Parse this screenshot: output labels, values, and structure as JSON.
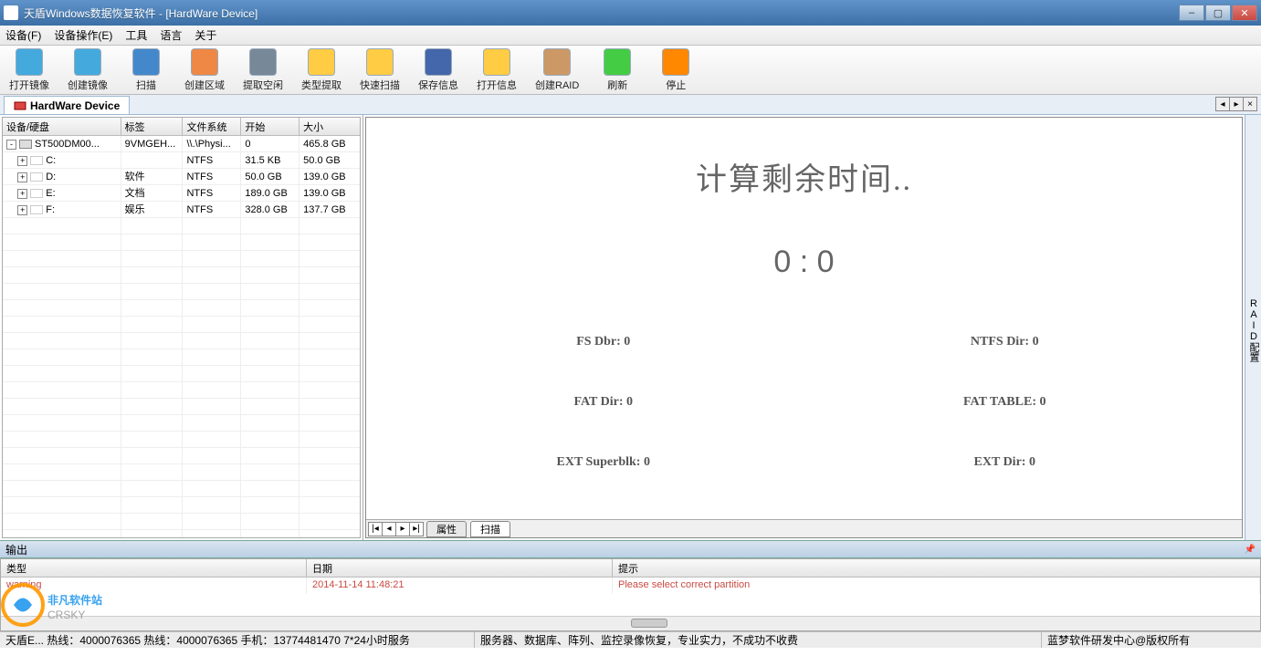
{
  "window": {
    "title": "天盾Windows数据恢复软件 - [HardWare Device]"
  },
  "menu": {
    "device": "设备(F)",
    "device_ops": "设备操作(E)",
    "tools": "工具",
    "language": "语言",
    "about": "关于"
  },
  "toolbar": [
    {
      "id": "open-image",
      "label": "打开镜像"
    },
    {
      "id": "create-image",
      "label": "创建镜像"
    },
    {
      "id": "scan",
      "label": "扫描"
    },
    {
      "id": "create-region",
      "label": "创建区域"
    },
    {
      "id": "extract-free",
      "label": "提取空闲"
    },
    {
      "id": "type-extract",
      "label": "类型提取"
    },
    {
      "id": "quick-scan",
      "label": "快速扫描"
    },
    {
      "id": "save-info",
      "label": "保存信息"
    },
    {
      "id": "open-info",
      "label": "打开信息"
    },
    {
      "id": "create-raid",
      "label": "创建RAID"
    },
    {
      "id": "refresh",
      "label": "刷新"
    },
    {
      "id": "stop",
      "label": "停止"
    }
  ],
  "doc_tab": {
    "label": "HardWare Device"
  },
  "vertical_tab": {
    "label": "RAID配置"
  },
  "device_table": {
    "headers": {
      "device": "设备/硬盘",
      "label": "标签",
      "fs": "文件系统",
      "start": "开始",
      "size": "大小"
    },
    "rows": [
      {
        "indent": 0,
        "exp": "-",
        "icon": true,
        "name": "ST500DM00...",
        "label": "9VMGEH...",
        "fs": "\\\\.\\Physi...",
        "start": "0",
        "size": "465.8 GB"
      },
      {
        "indent": 1,
        "exp": "+",
        "icon": false,
        "name": "C:",
        "label": "",
        "fs": "NTFS",
        "start": "31.5 KB",
        "size": "50.0 GB"
      },
      {
        "indent": 1,
        "exp": "+",
        "icon": false,
        "name": "D:",
        "label": "软件",
        "fs": "NTFS",
        "start": "50.0 GB",
        "size": "139.0 GB"
      },
      {
        "indent": 1,
        "exp": "+",
        "icon": false,
        "name": "E:",
        "label": "文档",
        "fs": "NTFS",
        "start": "189.0 GB",
        "size": "139.0 GB"
      },
      {
        "indent": 1,
        "exp": "+",
        "icon": false,
        "name": "F:",
        "label": "娱乐",
        "fs": "NTFS",
        "start": "328.0 GB",
        "size": "137.7 GB"
      }
    ]
  },
  "scan": {
    "title": "计算剩余时间..",
    "time": "0  :  0",
    "stats": {
      "fs_dbr": "FS    Dbr: 0",
      "ntfs_dir": "NTFS Dir: 0",
      "fat_dir": "FAT  Dir: 0",
      "fat_table": "FAT TABLE: 0",
      "ext_sb": "EXT Superblk: 0",
      "ext_dir": "EXT Dir: 0"
    }
  },
  "pane_tabs": {
    "props": "属性",
    "scan": "扫描"
  },
  "output": {
    "header": "输出",
    "cols": {
      "type": "类型",
      "date": "日期",
      "msg": "提示"
    },
    "rows": [
      {
        "type": "warning",
        "date": "2014-11-14 11:48:21",
        "msg": "Please select correct partition"
      }
    ]
  },
  "status": {
    "left": "天盾E... 热线：4000076365 热线：4000076365 手机：13774481470   7*24小时服务",
    "mid": "服务器、数据库、阵列、监控录像恢复，专业实力，不成功不收费",
    "right": "蓝梦软件研发中心@版权所有"
  },
  "watermark": {
    "text": "非凡软件站",
    "sub": "CRSKY"
  }
}
